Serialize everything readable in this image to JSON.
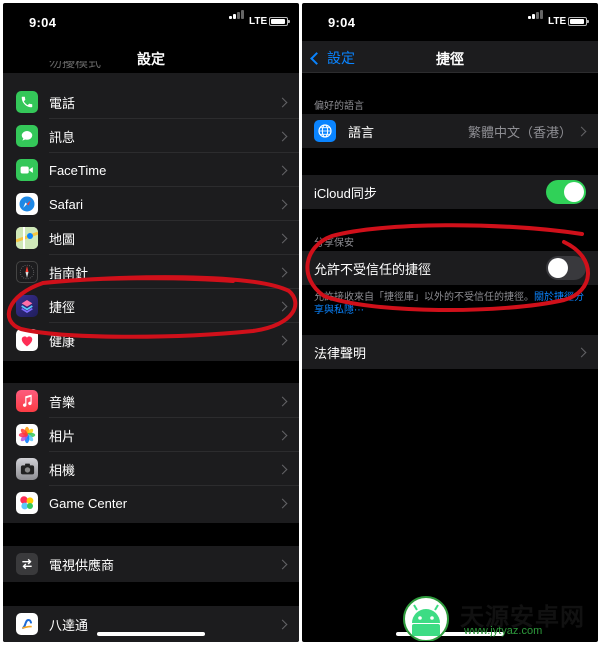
{
  "status": {
    "time": "9:04",
    "network": "LTE"
  },
  "settings_screen": {
    "title": "設定",
    "cutoff_item": "勿擾模式",
    "items": [
      {
        "label": "電話",
        "icon": "phone-icon",
        "color": "#34c759"
      },
      {
        "label": "訊息",
        "icon": "message-icon",
        "color": "#34c759"
      },
      {
        "label": "FaceTime",
        "icon": "facetime-icon",
        "color": "#34c759"
      },
      {
        "label": "Safari",
        "icon": "compass-icon",
        "color": "#ffffff"
      },
      {
        "label": "地圖",
        "icon": "map-icon",
        "color": "#ffffff"
      },
      {
        "label": "指南針",
        "icon": "compass-dial-icon",
        "color": "#1c1c1e"
      },
      {
        "label": "捷徑",
        "icon": "shortcuts-icon",
        "color": "#3a3a8c"
      },
      {
        "label": "健康",
        "icon": "heart-icon",
        "color": "#ffffff"
      },
      {
        "label": "音樂",
        "icon": "music-note-icon",
        "color": "#fc3c44"
      },
      {
        "label": "相片",
        "icon": "photos-flower-icon",
        "color": "#ffffff"
      },
      {
        "label": "相機",
        "icon": "camera-icon",
        "color": "#8e8e93"
      },
      {
        "label": "Game Center",
        "icon": "game-center-icon",
        "color": "#ffffff"
      },
      {
        "label": "電視供應商",
        "icon": "tv-provider-icon",
        "color": "#636366"
      },
      {
        "label": "八達通",
        "icon": "octopus-icon",
        "color": "#ffffff"
      }
    ]
  },
  "shortcuts_screen": {
    "back_label": "設定",
    "title": "捷徑",
    "pref_lang_header": "偏好的語言",
    "language_label": "語言",
    "language_value": "繁體中文（香港）",
    "icloud_label": "iCloud同步",
    "icloud_on": true,
    "sharing_header": "分享保安",
    "untrusted_label": "允許不受信任的捷徑",
    "untrusted_on": false,
    "footnote_text": "允許接收來自「捷徑庫」以外的不受信任的捷徑。",
    "footnote_link": "關於捷徑分享與私隱⋯",
    "legal_label": "法律聲明"
  },
  "watermark": {
    "title": "天源安卓网",
    "url": "www.jytyaz.com"
  },
  "colors": {
    "accent": "#0a84ff",
    "toggle_on": "#30d158",
    "annotation": "#d0101a",
    "cell_bg": "#1c1c1e"
  }
}
